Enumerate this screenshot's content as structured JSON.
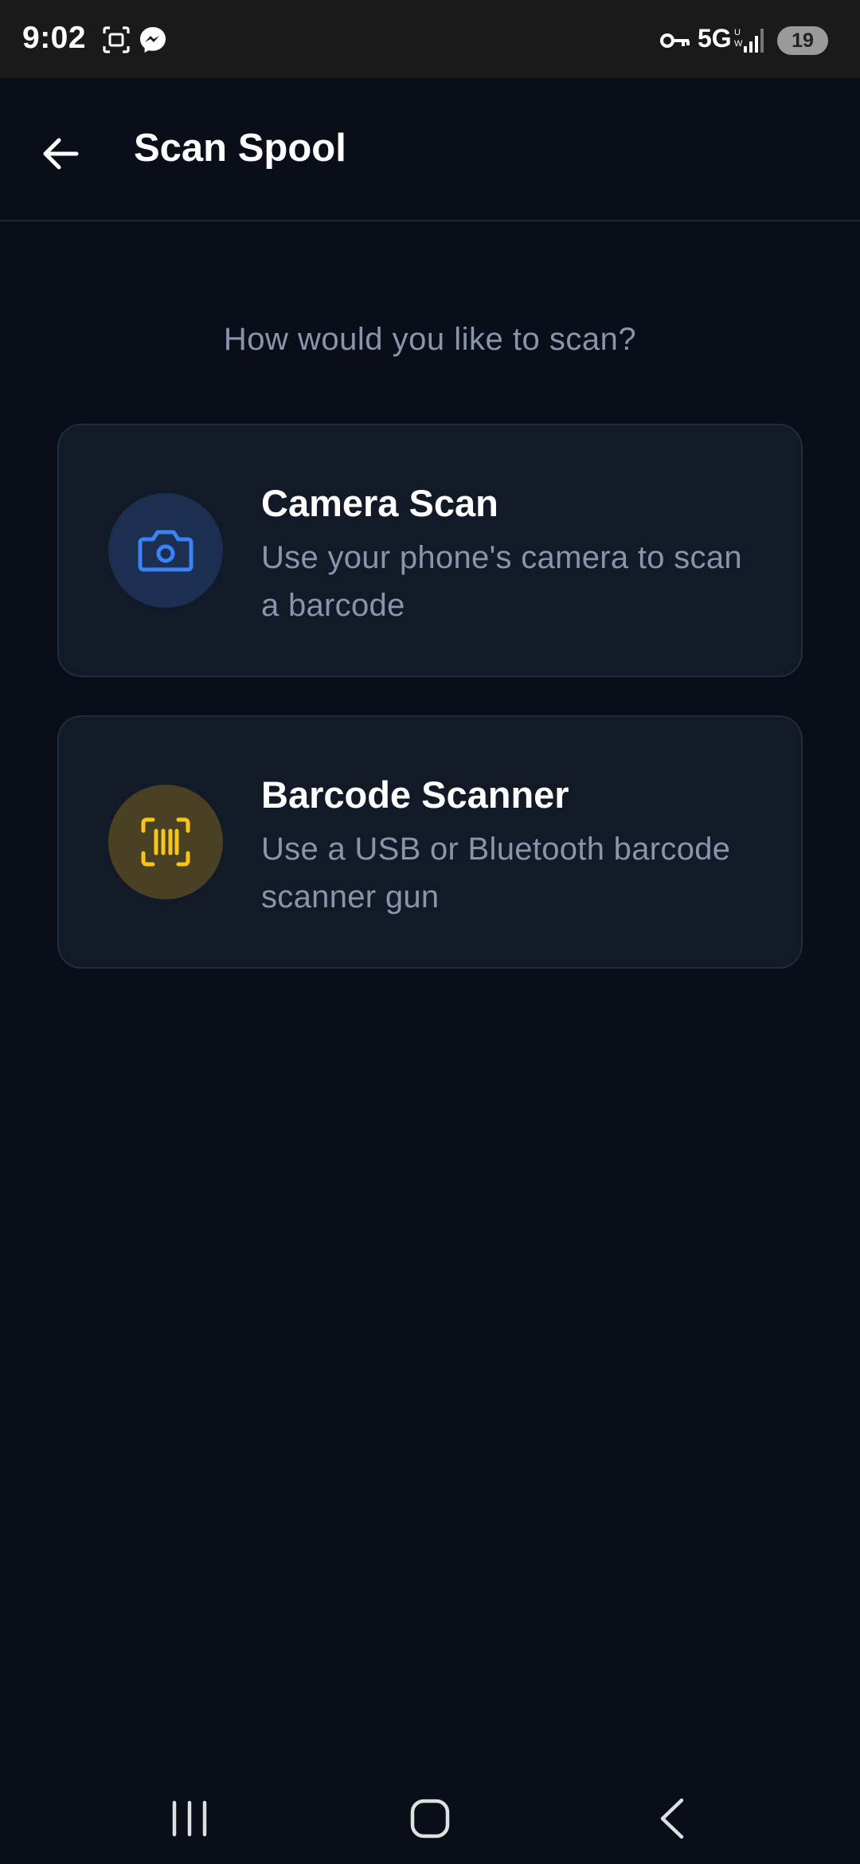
{
  "status_bar": {
    "time": "9:02",
    "network": "5G",
    "battery_level": "19",
    "icons": [
      "screenshot-icon",
      "messenger-icon",
      "vpn-key-icon",
      "signal-icon"
    ]
  },
  "header": {
    "title": "Scan Spool",
    "back_icon": "arrow-left-icon"
  },
  "prompt": "How would you like to scan?",
  "options": [
    {
      "title": "Camera Scan",
      "description": "Use your phone's camera to scan a barcode",
      "icon": "camera-icon",
      "accent": "#3b82f6"
    },
    {
      "title": "Barcode Scanner",
      "description": "Use a USB or Bluetooth barcode scanner gun",
      "icon": "barcode-scanner-icon",
      "accent": "#f5c518"
    }
  ],
  "colors": {
    "background": "#0a0e18",
    "card": "#121a28",
    "muted_text": "#8a94aa"
  },
  "nav_bar": {
    "icons": [
      "recents-icon",
      "home-icon",
      "back-icon"
    ]
  }
}
